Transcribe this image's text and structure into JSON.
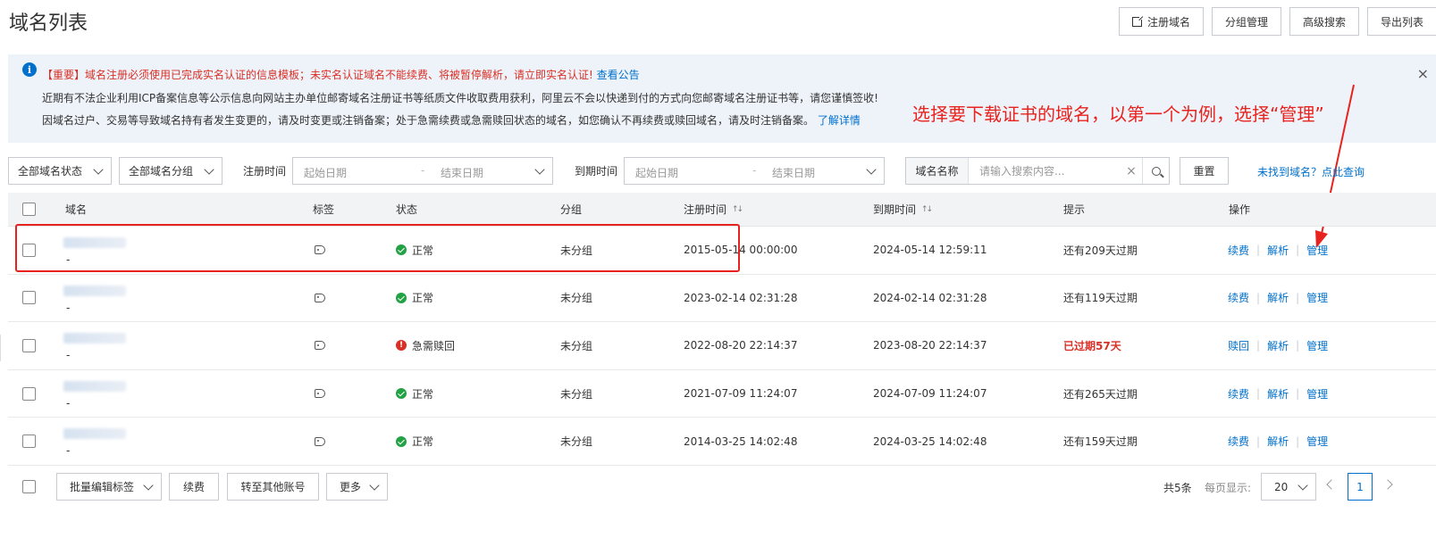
{
  "page": {
    "title": "域名列表"
  },
  "top_actions": [
    {
      "label": "注册域名",
      "icon": "external-link-icon"
    },
    {
      "label": "分组管理"
    },
    {
      "label": "高级搜索"
    },
    {
      "label": "导出列表"
    }
  ],
  "notice": {
    "line1": "【重要】域名注册必须使用已完成实名认证的信息模板；未实名认证域名不能续费、将被暂停解析，请立即实名认证!",
    "line1_link": "查看公告",
    "line2": "近期有不法企业利用ICP备案信息等公示信息向网站主办单位邮寄域名注册证书等纸质文件收取费用获利，阿里云不会以快递到付的方式向您邮寄域名注册证书等，请您谨慎签收!",
    "line3": "因域名过户、交易等导致域名持有者发生变更的，请及时变更或注销备案；处于急需续费或急需赎回状态的域名，如您确认不再续费或赎回域名，请及时注销备案。",
    "line3_link": "了解详情"
  },
  "annotation": {
    "text": "选择要下载证书的域名，以第一个为例，选择“管理”",
    "color": "#e8231f"
  },
  "filters": {
    "status_select": "全部域名状态",
    "group_select": "全部域名分组",
    "reg_time_label": "注册时间",
    "exp_time_label": "到期时间",
    "start_placeholder": "起始日期",
    "end_placeholder": "结束日期",
    "search_kind": "域名名称",
    "search_placeholder": "请输入搜索内容...",
    "reset_label": "重置",
    "not_found_link": "未找到域名？点此查询"
  },
  "table": {
    "headers": {
      "domain": "域名",
      "tag": "标签",
      "status": "状态",
      "group": "分组",
      "reg_time": "注册时间",
      "exp_time": "到期时间",
      "hint": "提示",
      "ops": "操作"
    },
    "rows": [
      {
        "dash": "-",
        "status": "正常",
        "status_type": "ok",
        "group": "未分组",
        "reg": "2015-05-14 00:00:00",
        "exp": "2024-05-14 12:59:11",
        "hint": "还有209天过期",
        "op1": "续费",
        "op2": "解析",
        "op3": "管理"
      },
      {
        "dash": "-",
        "status": "正常",
        "status_type": "ok",
        "group": "未分组",
        "reg": "2023-02-14 02:31:28",
        "exp": "2024-02-14 02:31:28",
        "hint": "还有119天过期",
        "op1": "续费",
        "op2": "解析",
        "op3": "管理"
      },
      {
        "dash": "-",
        "status": "急需赎回",
        "status_type": "warn",
        "group": "未分组",
        "reg": "2022-08-20 22:14:37",
        "exp": "2023-08-20 22:14:37",
        "hint": "已过期57天",
        "op1": "赎回",
        "op2": "解析",
        "op3": "管理"
      },
      {
        "dash": "-",
        "status": "正常",
        "status_type": "ok",
        "group": "未分组",
        "reg": "2021-07-09 11:24:07",
        "exp": "2024-07-09 11:24:07",
        "hint": "还有265天过期",
        "op1": "续费",
        "op2": "解析",
        "op3": "管理"
      },
      {
        "dash": "-",
        "status": "正常",
        "status_type": "ok",
        "group": "未分组",
        "reg": "2014-03-25 14:02:48",
        "exp": "2024-03-25 14:02:48",
        "hint": "还有159天过期",
        "op1": "续费",
        "op2": "解析",
        "op3": "管理"
      }
    ]
  },
  "footer": {
    "batch_tag": "批量编辑标签",
    "renew": "续费",
    "transfer": "转至其他账号",
    "more": "更多",
    "total": "共5条",
    "per_page_label": "每页显示:",
    "per_page_value": "20",
    "current_page": "1"
  },
  "colors": {
    "accent": "#0070cc",
    "danger": "#d93026",
    "success": "#23a245"
  }
}
